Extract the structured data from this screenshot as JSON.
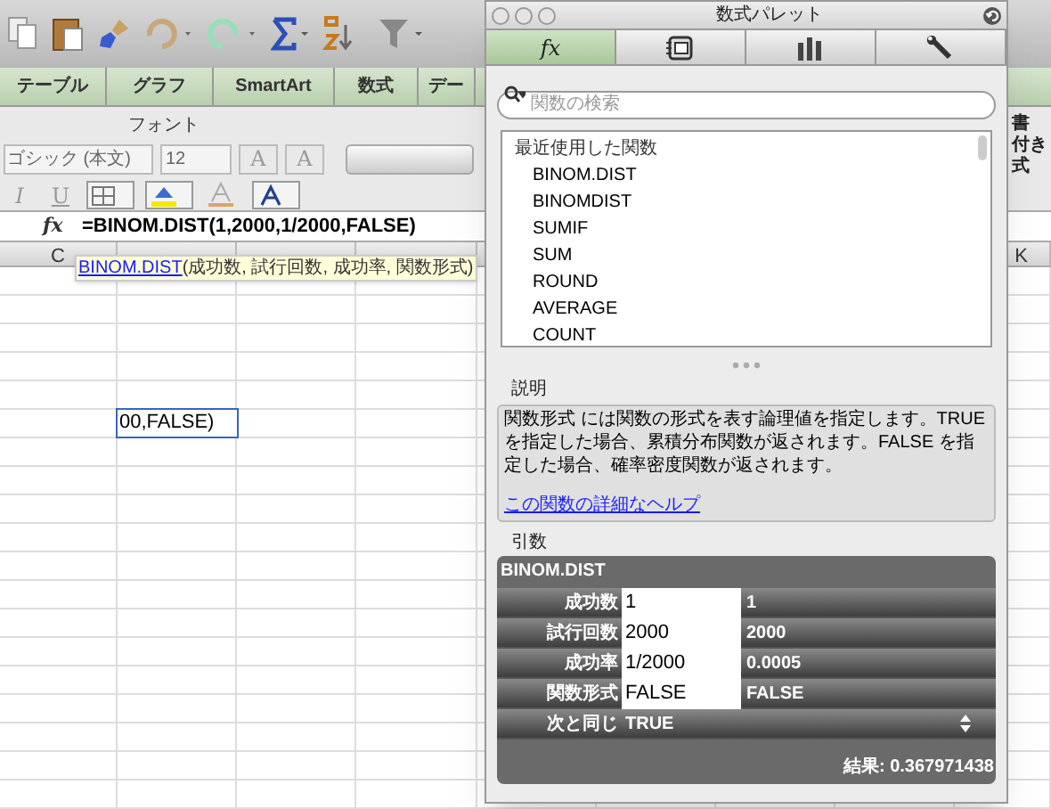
{
  "ribbon_tabs": [
    {
      "label": "テーブル"
    },
    {
      "label": "グラフ"
    },
    {
      "label": "SmartArt"
    },
    {
      "label": "数式"
    },
    {
      "label": "デー"
    }
  ],
  "ribbon": {
    "group_label": "フォント",
    "font_name": "ゴシック (本文)",
    "font_size": "12",
    "font_buttons": [
      "A",
      "A"
    ],
    "style_buttons": [
      "I",
      "U"
    ],
    "right_labels": [
      "書",
      "付き",
      "式"
    ]
  },
  "formula_bar": {
    "label": "fx",
    "formula": "=BINOM.DIST(1,2000,1/2000,FALSE)"
  },
  "tooltip": {
    "function": "BINOM.DIST",
    "arguments": "(成功数, 試行回数, 成功率, 関数形式)"
  },
  "column_headers": [
    "C",
    "K"
  ],
  "active_cell": "00,FALSE)",
  "palette": {
    "title": "数式パレット",
    "tabs": [
      {
        "label": "fx",
        "selected": true
      },
      {
        "selected": false
      },
      {
        "selected": false
      },
      {
        "selected": false
      }
    ],
    "search": {
      "placeholder": "関数の検索"
    },
    "list_header": "最近使用した関数",
    "functions": [
      "BINOM.DIST",
      "BINOMDIST",
      "SUMIF",
      "SUM",
      "ROUND",
      "AVERAGE",
      "COUNT"
    ],
    "description_label": "説明",
    "description": "関数形式 には関数の形式を表す論理値を指定します。TRUE を指定した場合、累積分布関数が返されます。FALSE を指定した場合、確率密度関数が返されます。",
    "help_link": "この関数の詳細なヘルプ",
    "arguments_label": "引数",
    "arguments": {
      "function": "BINOM.DIST",
      "rows": [
        {
          "label": "成功数",
          "value": "1",
          "result": "1"
        },
        {
          "label": "試行回数",
          "value": "2000",
          "result": "2000"
        },
        {
          "label": "成功率",
          "value": "1/2000",
          "result": "0.0005"
        },
        {
          "label": "関数形式",
          "value": "FALSE",
          "result": "FALSE"
        }
      ],
      "next_label": "次と同じ",
      "next_value": "TRUE",
      "result": "結果: 0.367971438"
    }
  }
}
